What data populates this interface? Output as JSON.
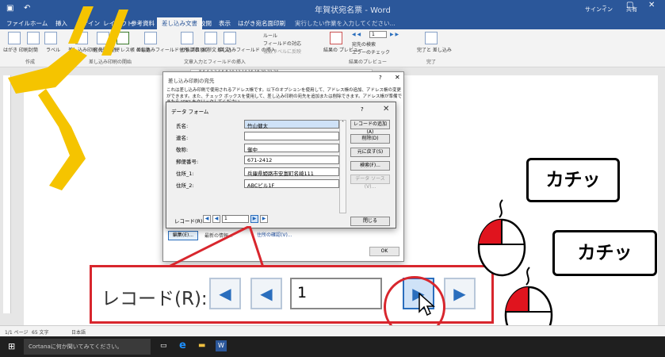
{
  "titlebar": {
    "title": "年賀状宛名票 - Word",
    "signin": "サインイン",
    "share": "共有"
  },
  "tabs": [
    {
      "label": "ファイル"
    },
    {
      "label": "ホーム"
    },
    {
      "label": "挿入"
    },
    {
      "label": "デザイン"
    },
    {
      "label": "レイアウト"
    },
    {
      "label": "参考資料"
    },
    {
      "label": "差し込み文書"
    },
    {
      "label": "校閲"
    },
    {
      "label": "表示"
    },
    {
      "label": "はがき宛名面印刷"
    },
    {
      "label": "実行したい作業を入力してください..."
    }
  ],
  "ribbon": {
    "btn_a": "はがき\n印刷",
    "btn_b": "封筒",
    "btn_c": "ラベル",
    "btn_d": "差し込み印刷\nの開始",
    "btn_e": "宛先の\n選択",
    "btn_f": "アドレス帳\nの編集",
    "btn_g": "差し込みフィールド\nの強調表示",
    "btn_h": "住所\nブロック",
    "btn_i": "挨拶文\n(英文)",
    "btn_j": "差し込みフィールド\nの挿入",
    "rule": "ルール",
    "field_match": "フィールドの対応",
    "update_labels": "複数ラベルに反映",
    "preview": "結果の\nプレビュー",
    "find_recipient": "宛先の検索",
    "error_check": "エラーのチェック",
    "finish": "完了と\n差し込み",
    "group_create": "作成",
    "group_start": "差し込み印刷の開始",
    "group_write": "文章入力とフィールドの挿入",
    "group_preview": "結果のプレビュー",
    "group_finish": "完了",
    "record_no": "1"
  },
  "ruler": "8  6  4  2    2  4  6  8  10  12  14  16  18  20  22  24",
  "mailmerge_dialog": {
    "title": "差し込み印刷の宛先",
    "description": "これは差し込み印刷で使用されるアドレス帳です。以下のオプションを使用して、アドレス帳の追加、アドレス帳の変更ができます。また、チェック ボックスを使用して、差し込み印刷の宛先を追加または削除できます。アドレス帳が準備できたら [OK] をクリックしてください。",
    "edit_button": "編集(E)...",
    "find_recipient": "最新の情報...",
    "check_address": "住所の確認(V)...",
    "ok_button": "OK"
  },
  "data_form": {
    "title": "データ フォーム",
    "help": "?",
    "fields": [
      {
        "label": "氏名:",
        "value": "竹山健太"
      },
      {
        "label": "連名:",
        "value": ""
      },
      {
        "label": "敬称:",
        "value": "御中"
      },
      {
        "label": "郵便番号:",
        "value": "671-2412"
      },
      {
        "label": "住所_1:",
        "value": "兵庫県姫路市安富町名崎111"
      },
      {
        "label": "住所_2:",
        "value": "ABCビル1F"
      }
    ],
    "buttons": [
      {
        "label": "レコードの追加(A)"
      },
      {
        "label": "削除(D)"
      },
      {
        "label": "元に戻す(S)"
      },
      {
        "label": "検索(F)..."
      },
      {
        "label": "データ ソース(V)..."
      }
    ],
    "close_button": "閉じる",
    "record_label": "レコード(R):",
    "record_value": "1"
  },
  "zoom_panel": {
    "label": "レコード(R):",
    "value": "1"
  },
  "callouts": [
    {
      "text": "カチッ"
    },
    {
      "text": "カチッ"
    }
  ],
  "statusbar": {
    "page": "1/1 ページ",
    "words": "65 文字",
    "lang": "日本語"
  },
  "taskbar": {
    "search": "Cortanaに何か聞いてみてください。"
  },
  "colors": {
    "word_blue": "#2b579a",
    "highlight_red": "#d8262d",
    "stroke_yellow": "#f5c400"
  }
}
